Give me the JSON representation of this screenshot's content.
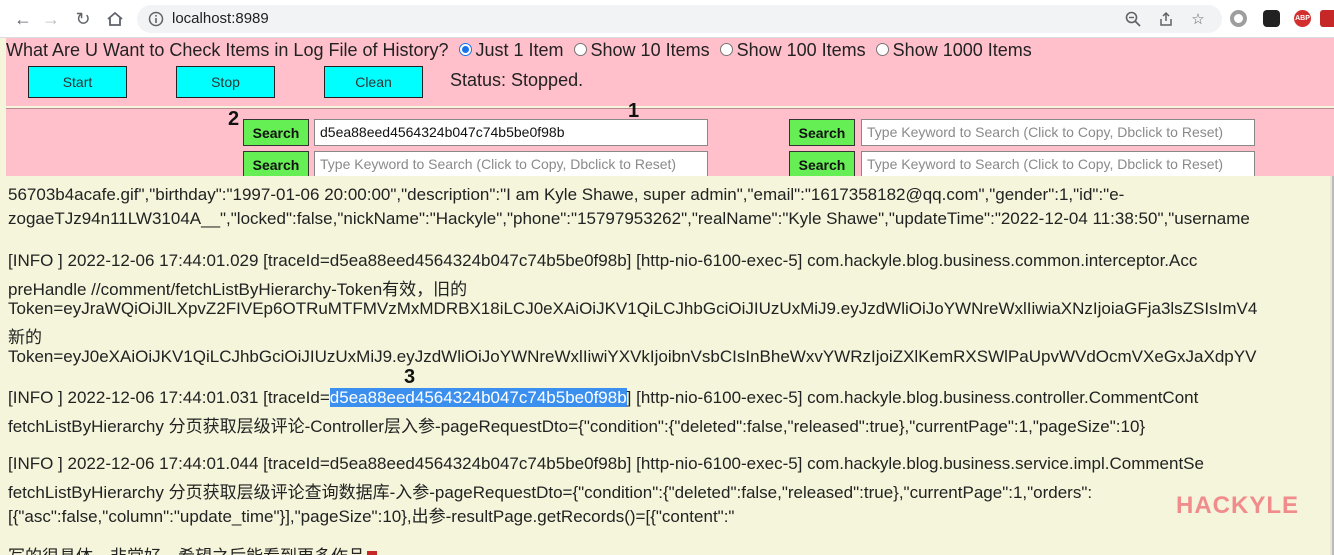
{
  "browser": {
    "url": "localhost:8989",
    "extensions": [
      {
        "name": "media-icon",
        "color": "#7a7a7a",
        "label": ""
      },
      {
        "name": "game-icon",
        "color": "#222222",
        "label": ""
      },
      {
        "name": "abp-icon",
        "color": "#d32f2f",
        "label": "ABP"
      },
      {
        "name": "shield-icon",
        "color": "#c62828",
        "label": ""
      }
    ]
  },
  "controls": {
    "question": "What Are U Want to Check Items in Log File of History?",
    "options": [
      "Just 1 Item",
      "Show 10 Items",
      "Show 100 Items",
      "Show 1000 Items"
    ],
    "selected_option": "Just 1 Item",
    "start_label": "Start",
    "stop_label": "Stop",
    "clean_label": "Clean",
    "status": "Status: Stopped."
  },
  "search": {
    "button_label": "Search",
    "placeholder": "Type Keyword to Search (Click to Copy, Dbclick to Reset)",
    "first_value": "d5ea88eed4564324b047c74b5be0f98b",
    "badges": [
      "1",
      "2",
      "3"
    ]
  },
  "log": {
    "line1": "56703b4acafe.gif\",\"birthday\":\"1997-01-06 20:00:00\",\"description\":\"I am Kyle Shawe, super admin\",\"email\":\"1617358182@qq.com\",\"gender\":1,\"id\":\"e-",
    "line2": "zogaeTJz94n11LW3104A__\",\"locked\":false,\"nickName\":\"Hackyle\",\"phone\":\"15797953262\",\"realName\":\"Kyle Shawe\",\"updateTime\":\"2022-12-04 11:38:50\",\"username",
    "line3": "[INFO ] 2022-12-06 17:44:01.029 [traceId=d5ea88eed4564324b047c74b5be0f98b] [http-nio-6100-exec-5] com.hackyle.blog.business.common.interceptor.Acc",
    "line4": "preHandle //comment/fetchListByHierarchy-Token有效，旧的",
    "line5": "Token=eyJraWQiOiJlLXpvZ2FIVEp6OTRuMTFMVzMxMDRBX18iLCJ0eXAiOiJKV1QiLCJhbGciOiJIUzUxMiJ9.eyJzdWliOiJoYWNreWxlIiwiaXNzIjoiaGFja3lsZSIsImV4",
    "line6": "新的",
    "line7": "Token=eyJ0eXAiOiJKV1QiLCJhbGciOiJIUzUxMiJ9.eyJzdWliOiJoYWNreWxlIiwiYXVkIjoibnVsbCIsInBheWxvYWRzIjoiZXlKemRXSWlPaUpvWVdOcmVXeGxJaXdpYV",
    "line8_prefix": "[INFO ] 2022-12-06 17:44:01.031 [traceId=",
    "line8_highlight": "d5ea88eed4564324b047c74b5be0f98b",
    "line8_suffix": "] [http-nio-6100-exec-5] com.hackyle.blog.business.controller.CommentCont",
    "line9": "fetchListByHierarchy 分页获取层级评论-Controller层入参-pageRequestDto={\"condition\":{\"deleted\":false,\"released\":true},\"currentPage\":1,\"pageSize\":10}",
    "line10": "[INFO ] 2022-12-06 17:44:01.044 [traceId=d5ea88eed4564324b047c74b5be0f98b] [http-nio-6100-exec-5] com.hackyle.blog.business.service.impl.CommentSe",
    "line11": "fetchListByHierarchy 分页获取层级评论查询数据库-入参-pageRequestDto={\"condition\":{\"deleted\":false,\"released\":true},\"currentPage\":1,\"orders\":",
    "line12": "[{\"asc\":false,\"column\":\"update_time\"}],\"pageSize\":10},出参-resultPage.getRecords()=[{\"content\":\"",
    "line13": "写的很具体，非常好，希望之后能看到更多作品",
    "watermark": "HACKYLE"
  }
}
